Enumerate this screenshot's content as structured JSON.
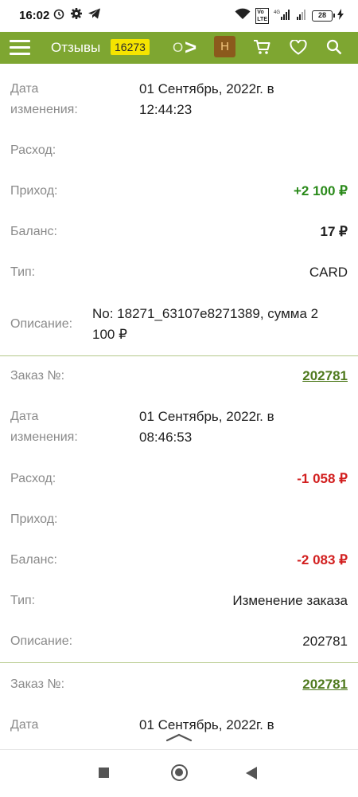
{
  "status": {
    "time": "16:02",
    "battery": "28"
  },
  "header": {
    "reviews_label": "Отзывы",
    "reviews_count": "16273",
    "cut_label": "О",
    "chevron": ">",
    "h_button": "Н"
  },
  "records": [
    {
      "date_label": "Дата изменения:",
      "date_line1": "01 Сентябрь, 2022г. в",
      "date_line2": "12:44:23",
      "expense_label": "Расход:",
      "expense": "",
      "income_label": "Приход:",
      "income": "+2 100 ₽",
      "balance_label": "Баланс:",
      "balance": "17 ₽",
      "type_label": "Тип:",
      "type": "CARD",
      "desc_label": "Описание:",
      "desc_line1": "No: 18271_63107e8271389, сумма 2",
      "desc_line2": "100 ₽"
    },
    {
      "order_label": "Заказ №:",
      "order": "202781",
      "date_label": "Дата изменения:",
      "date_line1": "01 Сентябрь, 2022г. в",
      "date_line2": "08:46:53",
      "expense_label": "Расход:",
      "expense": "-1 058 ₽",
      "income_label": "Приход:",
      "income": "",
      "balance_label": "Баланс:",
      "balance": "-2 083 ₽",
      "type_label": "Тип:",
      "type": "Изменение заказа",
      "desc_label": "Описание:",
      "desc": "202781"
    },
    {
      "order_label": "Заказ №:",
      "order": "202781",
      "date_label": "Дата",
      "date_line1": "01 Сентябрь, 2022г. в"
    }
  ],
  "colors": {
    "header_bg": "#7ea631",
    "badge_bg": "#f5e400",
    "h_button_bg": "#8b5a1c",
    "positive": "#2a8a1a",
    "negative": "#d21f1f",
    "link": "#4f7a1e"
  },
  "icons": [
    "menu-icon",
    "cart-icon",
    "heart-icon",
    "search-icon",
    "alarm-icon",
    "settings-icon",
    "telegram-icon",
    "wifi-icon",
    "signal-icon",
    "battery-icon"
  ]
}
